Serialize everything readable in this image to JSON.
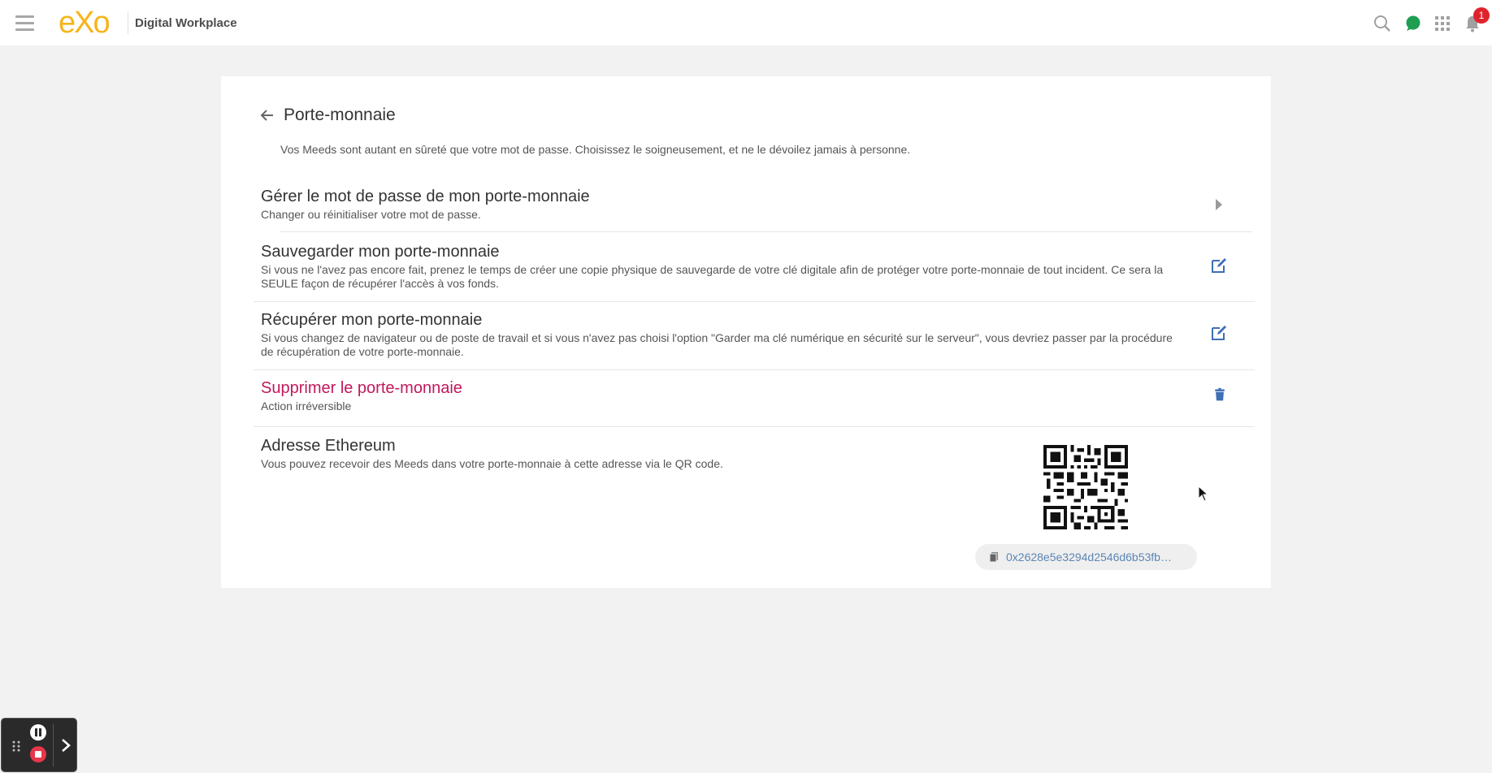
{
  "header": {
    "logo_text": "eXo",
    "site_title": "Digital Workplace",
    "notification_count": "1",
    "icons": [
      "menu-icon",
      "search-icon",
      "chat-icon",
      "apps-grid-icon",
      "bell-icon"
    ]
  },
  "page": {
    "title": "Porte-monnaie",
    "description": "Vos Meeds sont autant en sûreté que votre mot de passe. Choisissez le soigneusement, et ne le dévoilez jamais à personne."
  },
  "settings": [
    {
      "title": "Gérer le mot de passe de mon porte-monnaie",
      "subtitle": "Changer ou réinitialiser votre mot de passe.",
      "action_icon": "chevron-right-icon"
    },
    {
      "title": "Sauvegarder mon porte-monnaie",
      "subtitle": "Si vous ne l'avez pas encore fait, prenez le temps de créer une copie physique de sauvegarde de votre clé digitale afin de protéger votre porte-monnaie de tout incident. Ce sera la SEULE façon de récupérer l'accès à vos fonds.",
      "action_icon": "edit-icon"
    },
    {
      "title": "Récupérer mon porte-monnaie",
      "subtitle": "Si vous changez de navigateur ou de poste de travail et si vous n'avez pas choisi l'option \"Garder ma clé numérique en sécurité sur le serveur\", vous devriez passer par la procédure de récupération de votre porte-monnaie.",
      "action_icon": "edit-icon"
    },
    {
      "title": "Supprimer le porte-monnaie",
      "subtitle": "Action irréversible",
      "action_icon": "trash-icon"
    }
  ],
  "ethereum": {
    "title": "Adresse Ethereum",
    "subtitle": "Vous pouvez recevoir des Meeds dans votre porte-monnaie à cette adresse via le QR code.",
    "address": "0x2628e5e3294d2546d6b53fb3..."
  },
  "colors": {
    "brand": "#f7b51b",
    "danger": "#c2185b",
    "action": "#3f6fb5",
    "link": "#5b86b5",
    "badge": "#e0232b"
  }
}
